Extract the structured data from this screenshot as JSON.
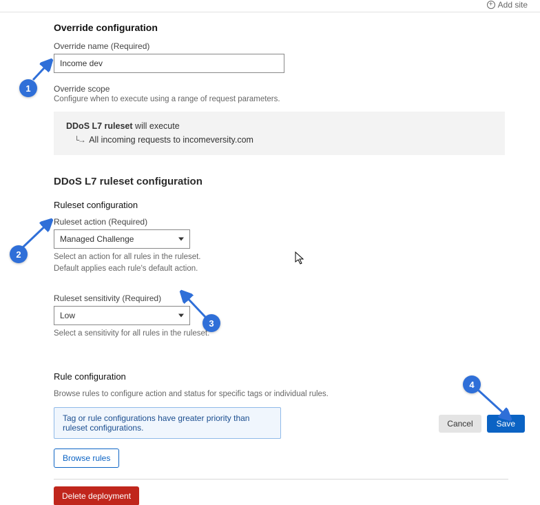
{
  "top_right": {
    "add_site": "Add site",
    "plus": "+"
  },
  "override": {
    "section_title": "Override configuration",
    "name_label": "Override name (Required)",
    "name_value": "Income dev",
    "scope_label": "Override scope",
    "scope_help": "Configure when to execute using a range of request parameters.",
    "exec_ruleset": "DDoS L7 ruleset",
    "exec_suffix": " will execute",
    "exec_requests": "All incoming requests to incomeversity.com"
  },
  "ruleset": {
    "title": "DDoS L7 ruleset configuration",
    "config_heading": "Ruleset configuration",
    "action_label": "Ruleset action (Required)",
    "action_value": "Managed Challenge",
    "action_help1": "Select an action for all rules in the ruleset.",
    "action_help2": "Default applies each rule's default action.",
    "sensitivity_label": "Ruleset sensitivity (Required)",
    "sensitivity_value": "Low",
    "sensitivity_help": "Select a sensitivity for all rules in the ruleset."
  },
  "rule_config": {
    "heading": "Rule configuration",
    "help": "Browse rules to configure action and status for specific tags or individual rules.",
    "banner": "Tag or rule configurations have greater priority than ruleset configurations.",
    "browse": "Browse rules"
  },
  "buttons": {
    "delete": "Delete deployment",
    "cancel": "Cancel",
    "save": "Save"
  },
  "annotations": {
    "b1": "1",
    "b2": "2",
    "b3": "3",
    "b4": "4"
  }
}
